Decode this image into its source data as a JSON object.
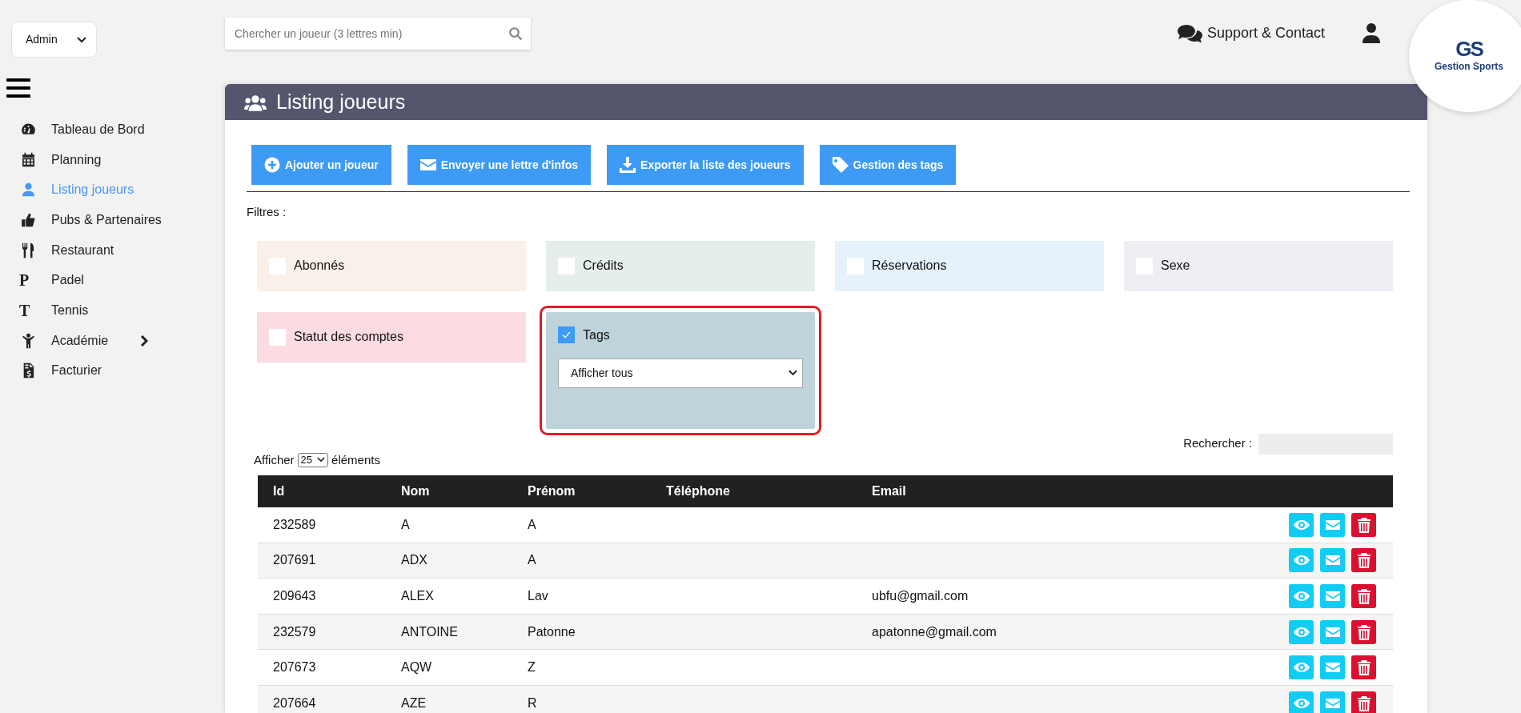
{
  "role_select": {
    "value": "Admin"
  },
  "sidebar": {
    "items": [
      {
        "label": "Tableau de Bord",
        "selected": false
      },
      {
        "label": "Planning",
        "selected": false
      },
      {
        "label": "Listing joueurs",
        "selected": true
      },
      {
        "label": "Pubs & Partenaires",
        "selected": false
      },
      {
        "label": "Restaurant",
        "selected": false
      },
      {
        "label": "Padel",
        "glyph": "P",
        "selected": false
      },
      {
        "label": "Tennis",
        "glyph": "T",
        "selected": false
      },
      {
        "label": "Académie",
        "has_submenu": true,
        "selected": false
      },
      {
        "label": "Facturier",
        "selected": false
      }
    ]
  },
  "search": {
    "placeholder": "Chercher un joueur (3 lettres min)"
  },
  "support_link": "Support & Contact",
  "logo": {
    "monogram": "GS",
    "name": "Gestion Sports"
  },
  "panel": {
    "title": "Listing joueurs",
    "buttons": [
      "Ajouter un joueur",
      "Envoyer une lettre d'infos",
      "Exporter la liste des joueurs",
      "Gestion des tags"
    ],
    "filters_label": "Filtres :",
    "filters": [
      {
        "label": "Abonnés",
        "color": "#faf0ea",
        "checked": false,
        "highlighted": false
      },
      {
        "label": "Crédits",
        "color": "#e5eeea",
        "checked": false,
        "highlighted": false
      },
      {
        "label": "Réservations",
        "color": "#e5f2fb",
        "checked": false,
        "highlighted": false
      },
      {
        "label": "Sexe",
        "color": "#efecf3",
        "checked": false,
        "highlighted": false
      },
      {
        "label": "Statut des comptes",
        "color": "#fcdbe3",
        "checked": false,
        "highlighted": false
      },
      {
        "label": "Tags",
        "color": "#bfd3da",
        "checked": true,
        "highlighted": true,
        "select_value": "Afficher tous"
      }
    ],
    "length": {
      "before": "Afficher",
      "value": "25",
      "after": "éléments"
    },
    "table_search_label": "Rechercher :",
    "table": {
      "columns": [
        "Id",
        "Nom",
        "Prénom",
        "Téléphone",
        "Email"
      ],
      "rows": [
        {
          "id": "232589",
          "nom": "A",
          "prenom": "A"
        },
        {
          "id": "207691",
          "nom": "ADX",
          "prenom": "A"
        },
        {
          "id": "209643",
          "nom": "ALEX",
          "prenom": "Lav",
          "email": "ubfu@gmail.com"
        },
        {
          "id": "232579",
          "nom": "ANTOINE",
          "prenom": "Patonne",
          "email": "apatonne@gmail.com"
        },
        {
          "id": "207673",
          "nom": "AQW",
          "prenom": "Z"
        },
        {
          "id": "207664",
          "nom": "AZE",
          "prenom": "R"
        }
      ]
    }
  }
}
